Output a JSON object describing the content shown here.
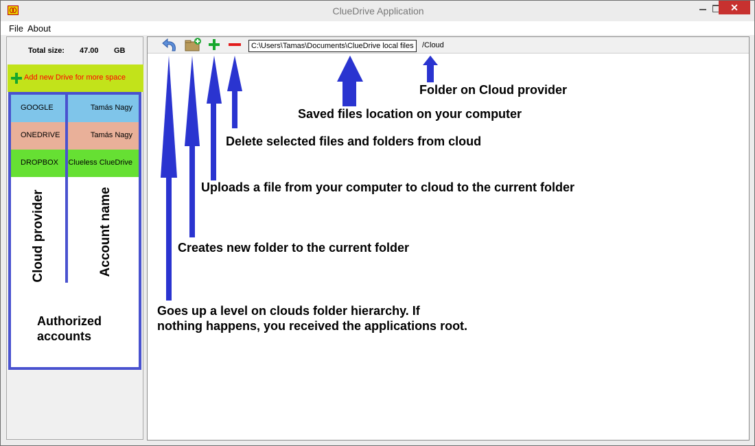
{
  "window": {
    "title": "ClueDrive Application",
    "close_glyph": "✕"
  },
  "menu": {
    "file": "File",
    "about": "About"
  },
  "left_panel": {
    "total_size_label": "Total size:",
    "total_size_value": "47.00",
    "total_size_unit": "GB",
    "add_drive_label": "Add new Drive for more space",
    "accounts": [
      {
        "provider": "GOOGLE",
        "name": "Tamás Nagy",
        "color": "#7fc5ea"
      },
      {
        "provider": "ONEDRIVE",
        "name": "Tamás Nagy",
        "color": "#e9b099"
      },
      {
        "provider": "DROPBOX",
        "name": "Clueless ClueDrive",
        "color": "#66e033"
      }
    ],
    "labels": {
      "cloud_provider": "Cloud provider",
      "account_name": "Account name",
      "authorized_accounts": "Authorized accounts"
    }
  },
  "toolbar": {
    "local_path": "C:\\Users\\Tamas\\Documents\\ClueDrive local files",
    "cloud_path": "/Cloud",
    "icons": [
      "up-level-icon",
      "new-folder-icon",
      "upload-plus-icon",
      "delete-minus-icon"
    ]
  },
  "annotations": {
    "folder_on_cloud": "Folder on Cloud provider",
    "saved_files_location": "Saved files location on your computer",
    "delete_selected": "Delete selected files and folders from cloud",
    "uploads_file": "Uploads a file from your computer to cloud to the current folder",
    "creates_folder": "Creates new folder to the current folder",
    "goes_up_line1": "Goes up a level on clouds folder hierarchy. If",
    "goes_up_line2": "nothing happens, you received the applications root."
  },
  "colors": {
    "accent_blue": "#2a34d0",
    "frame_blue": "#4952cf",
    "add_drive_bg": "#c2e31a",
    "add_drive_text": "#ff0000",
    "close_red": "#c7312f"
  }
}
